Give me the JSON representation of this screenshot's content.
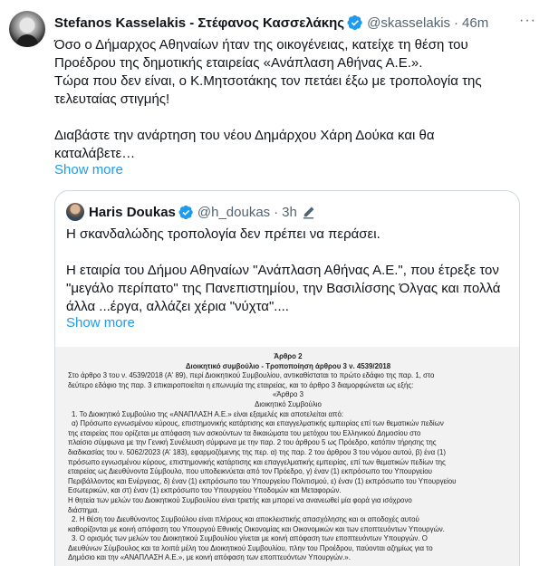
{
  "tweet": {
    "name": "Stefanos Kasselakis - Στέφανος Κασσελάκης",
    "handle": "@skasselakis",
    "dot": "·",
    "time": "46m",
    "more": "···",
    "lines": [
      "Όσο ο Δήμαρχος Αθηναίων ήταν της οικογένειας, κατείχε τη θέση του",
      "Προέδρου της δημοτικής εταιρείας «Ανάπλαση Αθήνας Α.Ε.».",
      "Τώρα που δεν είναι, ο Κ.Μητσοτάκης τον πετάει έξω με τροπολογία της",
      "τελευταίας στιγμής!",
      "Διαβάστε την ανάρτηση του νέου Δημάρχου Χάρη Δούκα και θα",
      "καταλάβετε…"
    ],
    "show_more": "Show more"
  },
  "quote": {
    "name": "Haris Doukas",
    "handle": "@h_doukas",
    "dot": "·",
    "time": "3h",
    "lines": [
      "Η σκανδαλώδης τροπολογία δεν πρέπει να περάσει.",
      "Η εταιρία του Δήμου Αθηναίων \"Ανάπλαση Αθήνας Α.Ε.\", που έτρεξε τον",
      "\"μεγάλο περίπατο\" της Πανεπιστημίου, την Βασιλίσσης Όλγας και πολλά",
      "άλλα ...έργα, αλλάζει χέρια \"νύχτα\"...."
    ],
    "show_more": "Show more"
  },
  "document": {
    "title": "Άρθρο 2",
    "subtitle": "Διοικητικό συμβούλιο - Τροποποίηση άρθρου 3 ν. 4539/2018",
    "lines": [
      "Στο άρθρο 3 του ν. 4539/2018 (Α' 89), περί Διοικητικού Συμβουλίου, αντικαθίσταται το πρώτο εδάφιο της παρ. 1, στο",
      "δεύτερο εδάφιο της παρ. 3 επικαιροποιείται η επωνυμία της εταιρείας, και το άρθρο 3 διαμορφώνεται ως εξής:",
      "«Άρθρο 3",
      "Διοικητικό Συμβούλιο",
      "1. Το Διοικητικό Συμβούλιο της «ΑΝΑΠΛΑΣΗ Α.Ε.» είναι εξαμελές και αποτελείται από:",
      "α) Πρόσωπο εγνωσμένου κύρους, επιστημονικής κατάρτισης και επαγγελματικής εμπειρίας επί των θεματικών πεδίων",
      "της εταιρείας που ορίζεται με απόφαση των ασκούντων τα δικαιώματα του μετόχου του Ελληνικού Δημοσίου στο",
      "πλαίσιο σύμφωνα με την Γενική Συνέλευση σύμφωνα με την παρ. 2 του άρθρου 5 ως Πρόεδρο, κατόπιν τήρησης της",
      "διαδικασίας του ν. 5062/2023 (Α' 183), εφαρμοζόμενης της περ. α) της παρ. 2 του άρθρου 3 του νόμου αυτού, β) ένα (1)",
      "πρόσωπο εγνωσμένου κύρους, επιστημονικής κατάρτισης και επαγγελματικής εμπειρίας, επί των θεματικών πεδίων της",
      "εταιρείας ως Διευθύνοντα Σύμβουλο, που υποδεικνύεται από τον Πρόεδρο, γ) έναν (1) εκπρόσωπο του Υπουργείου",
      "Περιβάλλοντος και Ενέργειας, δ) έναν (1) εκπρόσωπο του Υπουργείου Πολιτισμού, ε) έναν (1) εκπρόσωπο του Υπουργείου",
      "Εσωτερικών, και στ) έναν (1) εκπρόσωπο του Υπουργείου Υποδομών και Μεταφορών.",
      "Η θητεία των μελών του Διοικητικού Συμβουλίου είναι τριετής και μπορεί να ανανεωθεί μία φορά για ισόχρονο",
      "διάστημα.",
      "2. Η θέση του Διευθύνοντος Συμβούλου είναι πλήρους και αποκλειστικής απασχόλησης και οι αποδοχές αυτού",
      "καθορίζονται με κοινή απόφαση του Υπουργού Εθνικής Οικονομίας και Οικονομικών και των εποπτευόντων Υπουργών.",
      "3. Ο ορισμός των μελών του Διοικητικού Συμβουλίου γίνεται με κοινή απόφαση των εποπτευόντων Υπουργών. Ο",
      "Διευθύνων Σύμβουλος και τα λοιπά μέλη του Διοικητικού Συμβουλίου, πλην του Προέδρου, παύονται αζημίως για το",
      "Δημόσιο και την «ΑΝΑΠΛΑΣΗ Α.Ε.», με κοινή απόφαση των εποπτευόντων Υπουργών.»."
    ]
  }
}
